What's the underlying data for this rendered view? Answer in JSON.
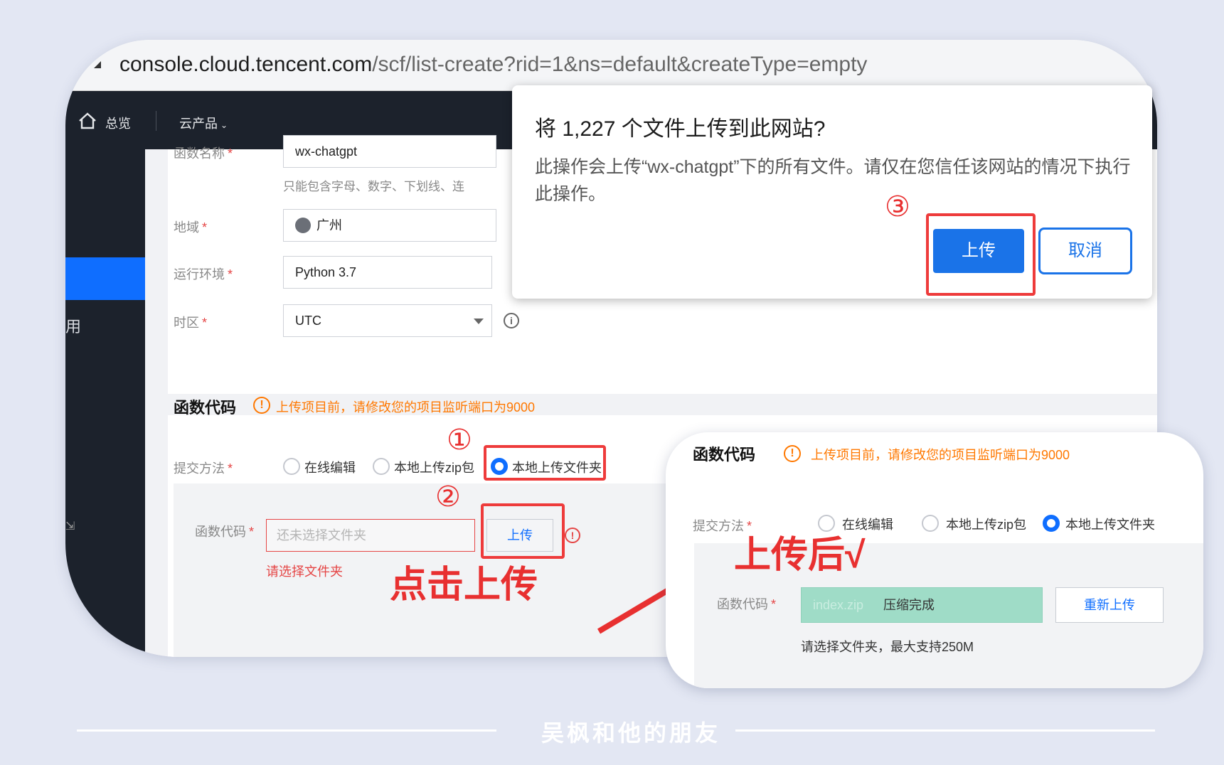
{
  "browser": {
    "url_host": "console.cloud.tencent.com",
    "url_path": "/scf/list-create?rid=1&ns=default&createType=empty"
  },
  "topnav": {
    "overview": "总览",
    "products": "云产品",
    "products_caret": "⌄"
  },
  "sidebar": {
    "visible_char": "用",
    "visible_icon": "⇲"
  },
  "form": {
    "function_name": {
      "label": "函数名称",
      "required": "*",
      "value": "wx-chatgpt",
      "hint": "只能包含字母、数字、下划线、连"
    },
    "region": {
      "label": "地域",
      "required": "*",
      "value": "广州"
    },
    "runtime": {
      "label": "运行环境",
      "required": "*",
      "value": "Python 3.7"
    },
    "timezone": {
      "label": "时区",
      "required": "*",
      "value": "UTC",
      "info_icon": "i"
    }
  },
  "code_section": {
    "title": "函数代码",
    "warn_icon": "!",
    "warning": "上传项目前，请修改您的项目监听端口为9000",
    "submit_label": "提交方法",
    "required": "*",
    "options": [
      "在线编辑",
      "本地上传zip包",
      "本地上传文件夹"
    ],
    "selected_option": 2,
    "code_label": "函数代码",
    "folder_placeholder": "还未选择文件夹",
    "upload_button": "上传",
    "error_icon": "!",
    "error_text": "请选择文件夹"
  },
  "dialog": {
    "title": "将 1,227 个文件上传到此网站?",
    "body": "此操作会上传“wx-chatgpt”下的所有文件。请仅在您信任该网站的情况下执行此操作。",
    "ok_button": "上传",
    "cancel_button": "取消"
  },
  "annotations": {
    "step1": "①",
    "step2": "②",
    "step3": "③",
    "click_upload": "点击上传",
    "after_upload": "上传后√"
  },
  "inset": {
    "title": "函数代码",
    "warn_icon": "!",
    "warning": "上传项目前，请修改您的项目监听端口为9000",
    "submit_label": "提交方法",
    "required": "*",
    "options": [
      "在线编辑",
      "本地上传zip包",
      "本地上传文件夹"
    ],
    "selected_option": 2,
    "code_label": "函数代码",
    "file_name": "index.zip",
    "file_status": "压缩完成",
    "reupload_button": "重新上传",
    "hint": "请选择文件夹，最大支持250M"
  },
  "footer": {
    "text": "吴枫和他的朋友"
  },
  "colors": {
    "accent": "#0f6eff",
    "annotation_red": "#e83030",
    "warning_orange": "#ff7800",
    "success_green": "#9fdcc7",
    "nav_dark": "#1c222c"
  }
}
